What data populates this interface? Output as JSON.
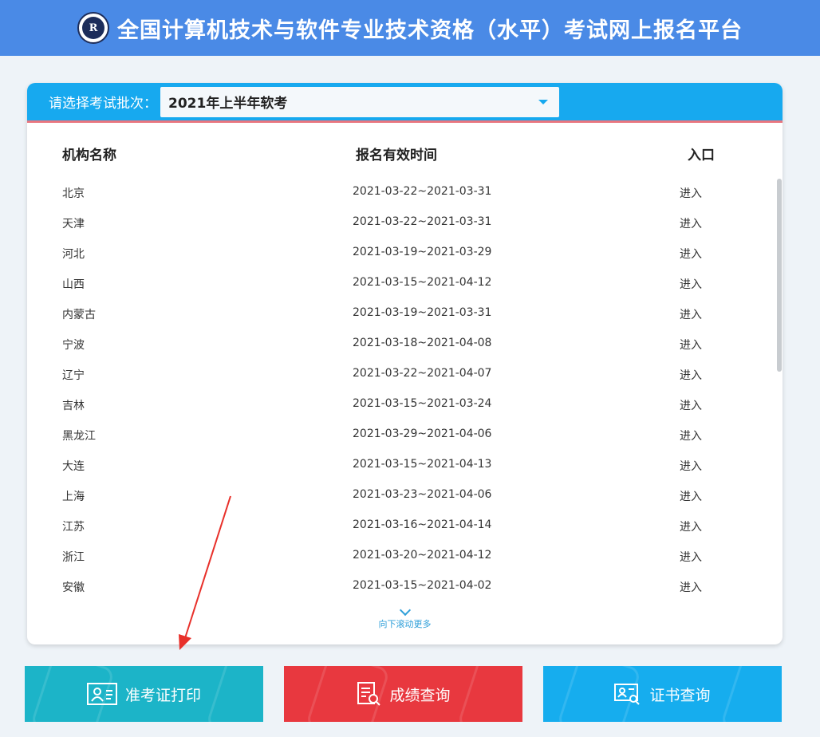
{
  "header": {
    "logo_text": "R",
    "title": "全国计算机技术与软件专业技术资格（水平）考试网上报名平台"
  },
  "batch": {
    "label": "请选择考试批次：",
    "selected": "2021年上半年软考"
  },
  "table": {
    "columns": [
      "机构名称",
      "报名有效时间",
      "入口"
    ],
    "rows": [
      {
        "name": "北京",
        "period": "2021-03-22~2021-03-31",
        "entry": "进入"
      },
      {
        "name": "天津",
        "period": "2021-03-22~2021-03-31",
        "entry": "进入"
      },
      {
        "name": "河北",
        "period": "2021-03-19~2021-03-29",
        "entry": "进入"
      },
      {
        "name": "山西",
        "period": "2021-03-15~2021-04-12",
        "entry": "进入"
      },
      {
        "name": "内蒙古",
        "period": "2021-03-19~2021-03-31",
        "entry": "进入"
      },
      {
        "name": "宁波",
        "period": "2021-03-18~2021-04-08",
        "entry": "进入"
      },
      {
        "name": "辽宁",
        "period": "2021-03-22~2021-04-07",
        "entry": "进入"
      },
      {
        "name": "吉林",
        "period": "2021-03-15~2021-03-24",
        "entry": "进入"
      },
      {
        "name": "黑龙江",
        "period": "2021-03-29~2021-04-06",
        "entry": "进入"
      },
      {
        "name": "大连",
        "period": "2021-03-15~2021-04-13",
        "entry": "进入"
      },
      {
        "name": "上海",
        "period": "2021-03-23~2021-04-06",
        "entry": "进入"
      },
      {
        "name": "江苏",
        "period": "2021-03-16~2021-04-14",
        "entry": "进入"
      },
      {
        "name": "浙江",
        "period": "2021-03-20~2021-04-12",
        "entry": "进入"
      },
      {
        "name": "安徽",
        "period": "2021-03-15~2021-04-02",
        "entry": "进入"
      }
    ]
  },
  "scroll_hint": "向下滚动更多",
  "buttons": {
    "admission_ticket": {
      "label": "准考证打印",
      "icon": "id-card-icon",
      "color": "#1cb4c8"
    },
    "score": {
      "label": "成绩查询",
      "icon": "document-search-icon",
      "color": "#e8383f"
    },
    "certificate": {
      "label": "证书查询",
      "icon": "certificate-search-icon",
      "color": "#16adee"
    }
  },
  "colors": {
    "header": "#4a8ae6",
    "panel_bar": "#17a9ef",
    "annotation_arrow": "#e8302a"
  }
}
